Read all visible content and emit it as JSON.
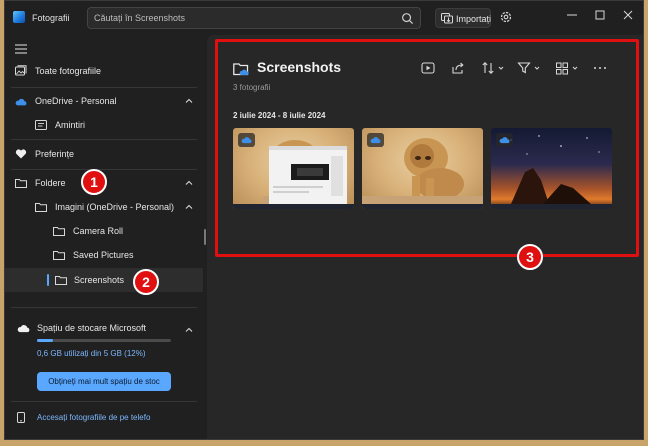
{
  "app": {
    "title": "Fotografii"
  },
  "search": {
    "placeholder": "Căutați în Screenshots"
  },
  "header": {
    "import_label": "Importați"
  },
  "sidebar": {
    "items": [
      {
        "label": "Toate fotografiile"
      },
      {
        "label": "OneDrive - Personal"
      },
      {
        "label": "Amintiri"
      },
      {
        "label": "Preferințe"
      },
      {
        "label": "Foldere"
      },
      {
        "label": "Imagini (OneDrive - Personal)"
      },
      {
        "label": "Camera Roll"
      },
      {
        "label": "Saved Pictures"
      },
      {
        "label": "Screenshots"
      }
    ],
    "storage": {
      "title": "Spațiu de stocare Microsoft",
      "usage_text": "0,6 GB utilizați din 5 GB (12%)",
      "used_fraction": 0.12,
      "button_label": "Obțineți mai mult spațiu de stoc",
      "phone_link": "Accesați fotografiile de pe telefo"
    }
  },
  "main": {
    "folder_title": "Screenshots",
    "count": "3 fotografii",
    "date_range": "2 iulie 2024 - 8 iulie 2024",
    "thumbnails": [
      {
        "kind": "lion-with-window"
      },
      {
        "kind": "lion"
      },
      {
        "kind": "night-sky"
      }
    ]
  },
  "annotations": [
    "1",
    "2",
    "3"
  ],
  "colors": {
    "accent": "#5aa7ff",
    "annotation": "#e01010",
    "background": "#202020"
  }
}
